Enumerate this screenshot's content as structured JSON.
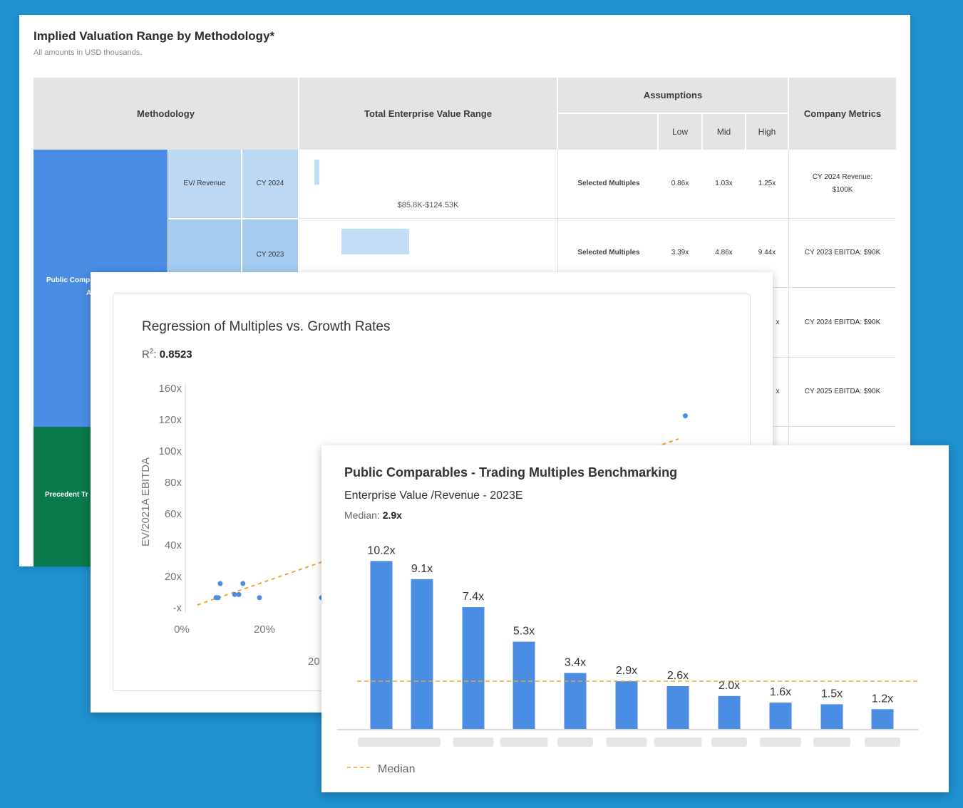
{
  "valuation": {
    "title": "Implied Valuation Range by Methodology*",
    "subtitle": "All amounts in USD thousands.",
    "headers": {
      "methodology": "Methodology",
      "tev_range": "Total Enterprise Value Range",
      "assumptions": "Assumptions",
      "low": "Low",
      "mid": "Mid",
      "high": "High",
      "company_metrics": "Company Metrics"
    },
    "groups": {
      "public": "Public Comp",
      "public_cont": "A",
      "precedent": "Precedent Tr"
    },
    "rows": [
      {
        "metric": "EV/ Revenue",
        "period": "CY 2024",
        "range": "$85.8K-$124.53K",
        "label": "Selected Multiples",
        "low": "0.86x",
        "mid": "1.03x",
        "high": "1.25x",
        "company_metric_1": "CY 2024 Revenue:",
        "company_metric_2": "$100K"
      },
      {
        "metric": "",
        "period": "CY 2023",
        "range": "",
        "label": "Selected Multiples",
        "low": "3.39x",
        "mid": "4.86x",
        "high": "9.44x",
        "company_metric_1": "CY 2023 EBITDA: $90K",
        "company_metric_2": ""
      },
      {
        "metric": "",
        "period": "",
        "range": "",
        "label": "",
        "low": "",
        "mid": "",
        "high": "x",
        "company_metric_1": "CY 2024 EBITDA: $90K",
        "company_metric_2": ""
      },
      {
        "metric": "",
        "period": "",
        "range": "",
        "label": "",
        "low": "",
        "mid": "",
        "high": "x",
        "company_metric_1": "CY 2025 EBITDA: $90K",
        "company_metric_2": ""
      }
    ],
    "colors": {
      "public_block": "#4a8de3",
      "precedent_block": "#087a4b",
      "header_bg": "#e4e4e4",
      "bar": "#c3dcf5"
    }
  },
  "regression": {
    "title": "Regression of Multiples vs. Growth Rates",
    "r2_label": "R",
    "r2_sup": "2",
    "r2_sep": ":",
    "r2_value": "0.8523",
    "chart_data": {
      "type": "scatter",
      "ylabel": "EV/2021A EBITDA",
      "y_ticks": [
        "-x",
        "20x",
        "40x",
        "60x",
        "80x",
        "100x",
        "120x",
        "160x"
      ],
      "x_ticks": [
        "0%",
        "20%"
      ],
      "x_ticks_partial": "20",
      "points": [
        {
          "x": 4.5,
          "y": 6
        },
        {
          "x": 5,
          "y": 6
        },
        {
          "x": 5.5,
          "y": 15
        },
        {
          "x": 9,
          "y": 8
        },
        {
          "x": 10,
          "y": 8
        },
        {
          "x": 11,
          "y": 15
        },
        {
          "x": 15,
          "y": 6
        },
        {
          "x": 30,
          "y": 6
        },
        {
          "x": 118,
          "y": 122
        }
      ],
      "trend_color": "#f5a623",
      "point_color": "#4a8de3"
    }
  },
  "benchmark": {
    "title": "Public Comparables - Trading Multiples Benchmarking",
    "subtitle": "Enterprise Value /Revenue - 2023E",
    "median_label": "Median:",
    "median_value": "2.9x",
    "legend": "Median",
    "chart_data": {
      "type": "bar",
      "categories": [
        "",
        "",
        "",
        "",
        "",
        "",
        "",
        "",
        "",
        "",
        ""
      ],
      "values": [
        10.2,
        9.1,
        7.4,
        5.3,
        3.4,
        2.9,
        2.6,
        2.0,
        1.6,
        1.5,
        1.2
      ],
      "labels": [
        "10.2x",
        "9.1x",
        "7.4x",
        "5.3x",
        "3.4x",
        "2.9x",
        "2.6x",
        "2.0x",
        "1.6x",
        "1.5x",
        "1.2x"
      ],
      "median": 2.9,
      "ylim": [
        0,
        10.2
      ],
      "bar_color": "#4a8de3",
      "median_color": "#f5a623"
    }
  }
}
